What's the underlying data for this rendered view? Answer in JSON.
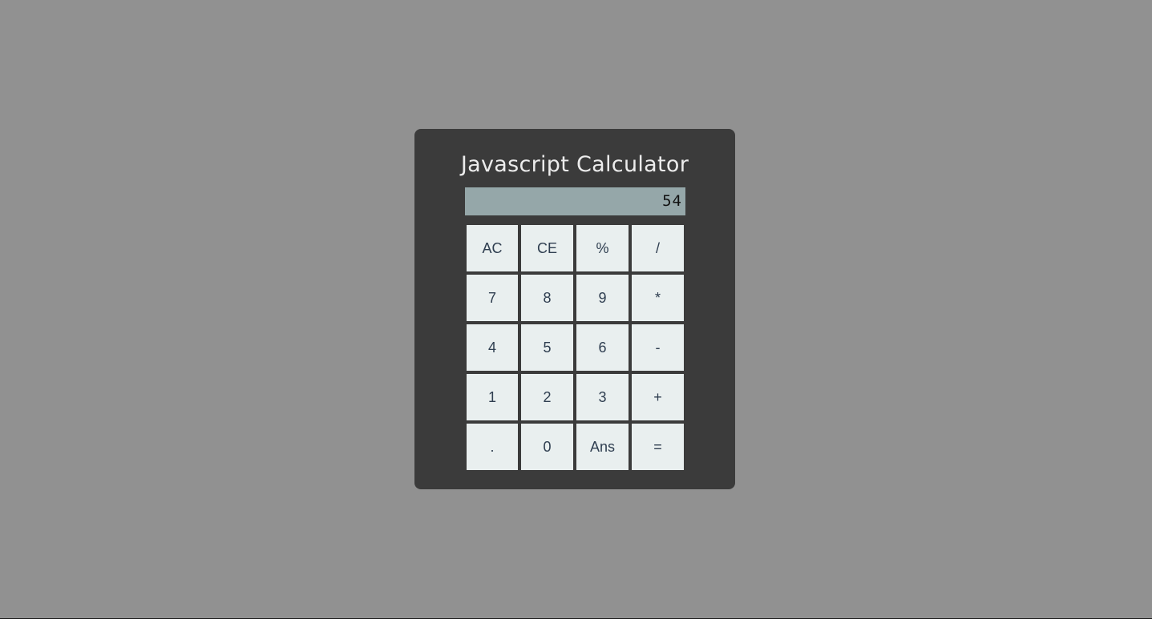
{
  "calculator": {
    "title": "Javascript Calculator",
    "display_value": "54",
    "keys": [
      {
        "label": "AC",
        "name": "key-all-clear"
      },
      {
        "label": "CE",
        "name": "key-clear-entry"
      },
      {
        "label": "%",
        "name": "key-percent"
      },
      {
        "label": "/",
        "name": "key-divide"
      },
      {
        "label": "7",
        "name": "key-7"
      },
      {
        "label": "8",
        "name": "key-8"
      },
      {
        "label": "9",
        "name": "key-9"
      },
      {
        "label": "*",
        "name": "key-multiply"
      },
      {
        "label": "4",
        "name": "key-4"
      },
      {
        "label": "5",
        "name": "key-5"
      },
      {
        "label": "6",
        "name": "key-6"
      },
      {
        "label": "-",
        "name": "key-subtract"
      },
      {
        "label": "1",
        "name": "key-1"
      },
      {
        "label": "2",
        "name": "key-2"
      },
      {
        "label": "3",
        "name": "key-3"
      },
      {
        "label": "+",
        "name": "key-add"
      },
      {
        "label": ".",
        "name": "key-decimal"
      },
      {
        "label": "0",
        "name": "key-0"
      },
      {
        "label": "Ans",
        "name": "key-answer"
      },
      {
        "label": "=",
        "name": "key-equals"
      }
    ]
  },
  "colors": {
    "page_background": "#919191",
    "calculator_body": "#3b3b3b",
    "display_background": "#95a7a9",
    "key_background": "#e9efef",
    "key_text": "#2f3e50",
    "title_text": "#ececec"
  }
}
